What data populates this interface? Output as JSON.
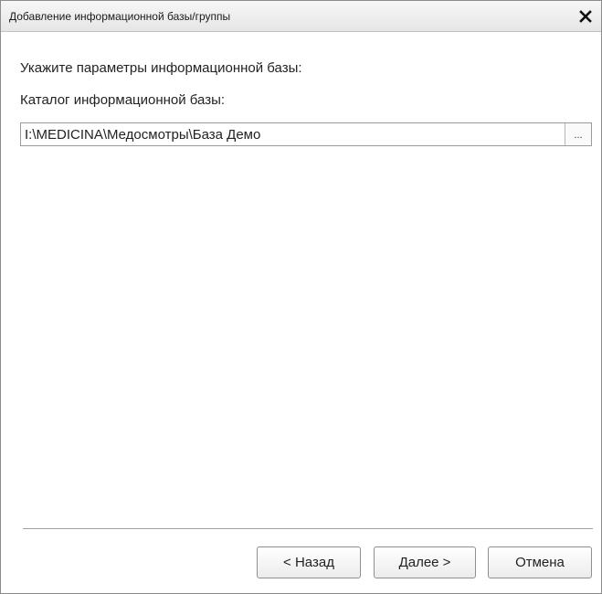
{
  "window": {
    "title": "Добавление информационной базы/группы",
    "close_icon": "close-icon"
  },
  "form": {
    "prompt": "Укажите параметры информационной базы:",
    "catalog_label": "Каталог информационной базы:",
    "catalog_value": "I:\\MEDICINA\\Медосмотры\\База Демо",
    "browse_label": "..."
  },
  "buttons": {
    "back": "< Назад",
    "next": "Далее >",
    "cancel": "Отмена"
  }
}
